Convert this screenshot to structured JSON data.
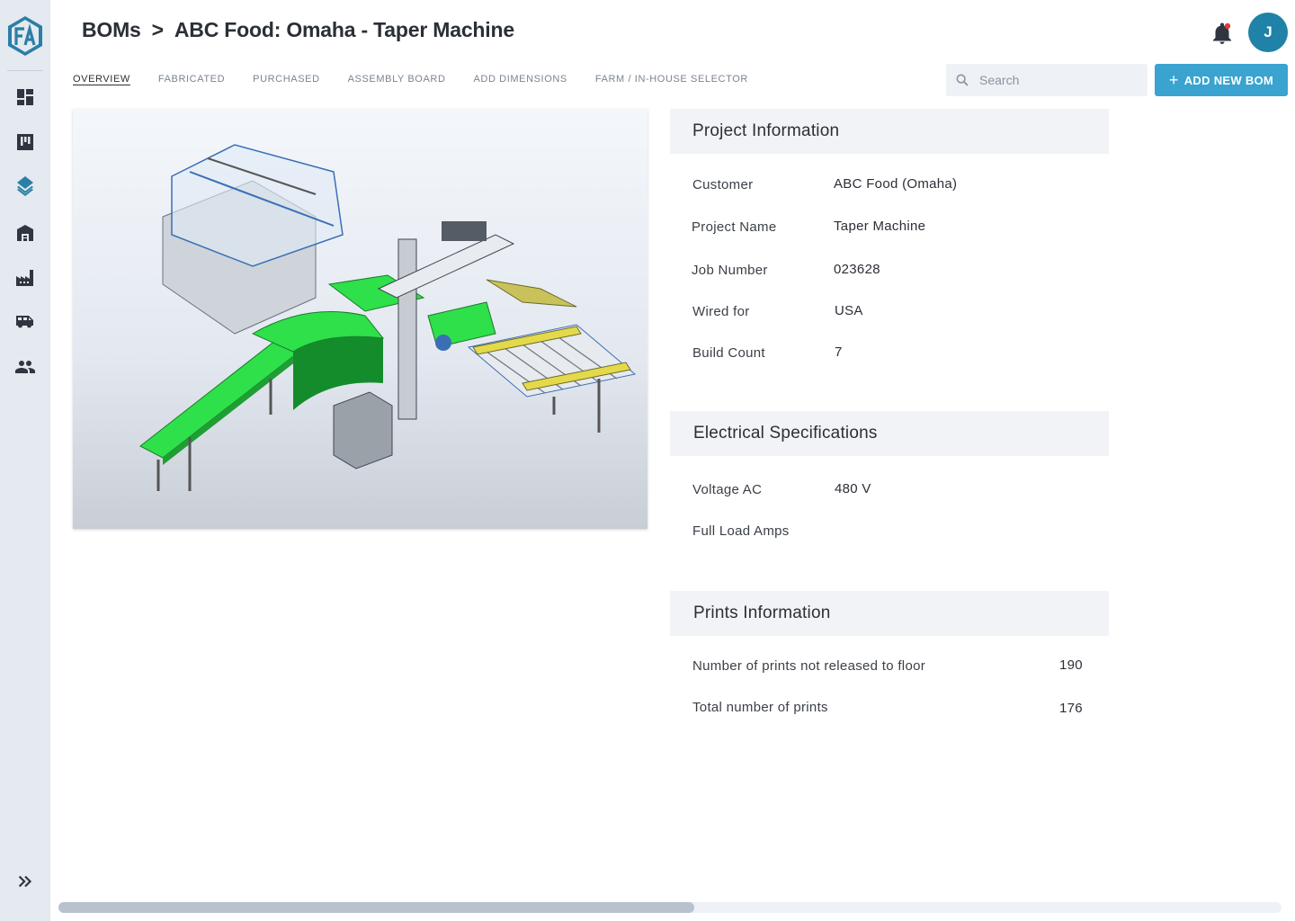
{
  "breadcrumb": {
    "root": "BOMs",
    "separator": ">",
    "current": "ABC Food: Omaha - Taper Machine"
  },
  "user": {
    "initial": "J",
    "avatar_color": "#1f82a6"
  },
  "sidebar": {
    "items": [
      {
        "icon": "dashboard-icon"
      },
      {
        "icon": "board-icon"
      },
      {
        "icon": "layers-icon",
        "active": true
      },
      {
        "icon": "warehouse-icon"
      },
      {
        "icon": "factory-icon"
      },
      {
        "icon": "truck-icon"
      },
      {
        "icon": "users-icon"
      }
    ],
    "expand_icon": "double-chevron-right-icon"
  },
  "tabs": [
    {
      "label": "OVERVIEW",
      "active": true
    },
    {
      "label": "FABRICATED"
    },
    {
      "label": "PURCHASED"
    },
    {
      "label": "ASSEMBLY BOARD"
    },
    {
      "label": "ADD DIMENSIONS"
    },
    {
      "label": "FARM / IN-HOUSE SELECTOR"
    }
  ],
  "search": {
    "placeholder": "Search"
  },
  "add_button": {
    "label": "ADD NEW BOM",
    "color": "#3aa3d0"
  },
  "project_info": {
    "title": "Project Information",
    "rows": [
      {
        "label": "Customer",
        "value": "ABC Food (Omaha)"
      },
      {
        "label": "Project Name",
        "value": "Taper Machine"
      },
      {
        "label": "Job Number",
        "value": "023628"
      },
      {
        "label": "Wired for",
        "value": "USA"
      },
      {
        "label": "Build Count",
        "value": "7"
      }
    ]
  },
  "electrical": {
    "title": "Electrical Specifications",
    "rows": [
      {
        "label": "Voltage AC",
        "value": "480 V"
      },
      {
        "label": "Full Load Amps",
        "value": ""
      }
    ]
  },
  "prints": {
    "title": "Prints Information",
    "rows": [
      {
        "label": "Number of prints not released to floor",
        "value": "190"
      },
      {
        "label": "Total number of prints",
        "value": "176"
      }
    ]
  },
  "scrollbar": {
    "position_fraction": 0.52
  },
  "colors": {
    "accent": "#3aa3d0",
    "sidebar_bg": "#e5e9f0",
    "icon": "#2f3640",
    "active_icon": "#2a7fa6",
    "conveyor_green": "#2ee04a"
  }
}
